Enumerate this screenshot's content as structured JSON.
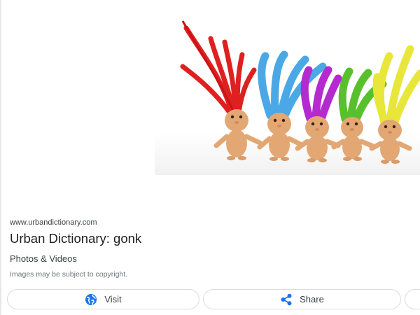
{
  "result": {
    "source_url": "www.urbandictionary.com",
    "title": "Urban Dictionary: gonk",
    "subtitle": "Photos & Videos",
    "copyright_note": "Images may be subject to copyright."
  },
  "preview": {
    "image_subject": "troll-dolls-image",
    "hair_colors": [
      "#e02020",
      "#4aa8e6",
      "#b52ad0",
      "#58c02c",
      "#e8e63a"
    ]
  },
  "actions": {
    "visit_label": "Visit",
    "share_label": "Share",
    "visit_icon": "globe-icon",
    "share_icon": "share-icon",
    "accent_color": "#1a73e8"
  }
}
